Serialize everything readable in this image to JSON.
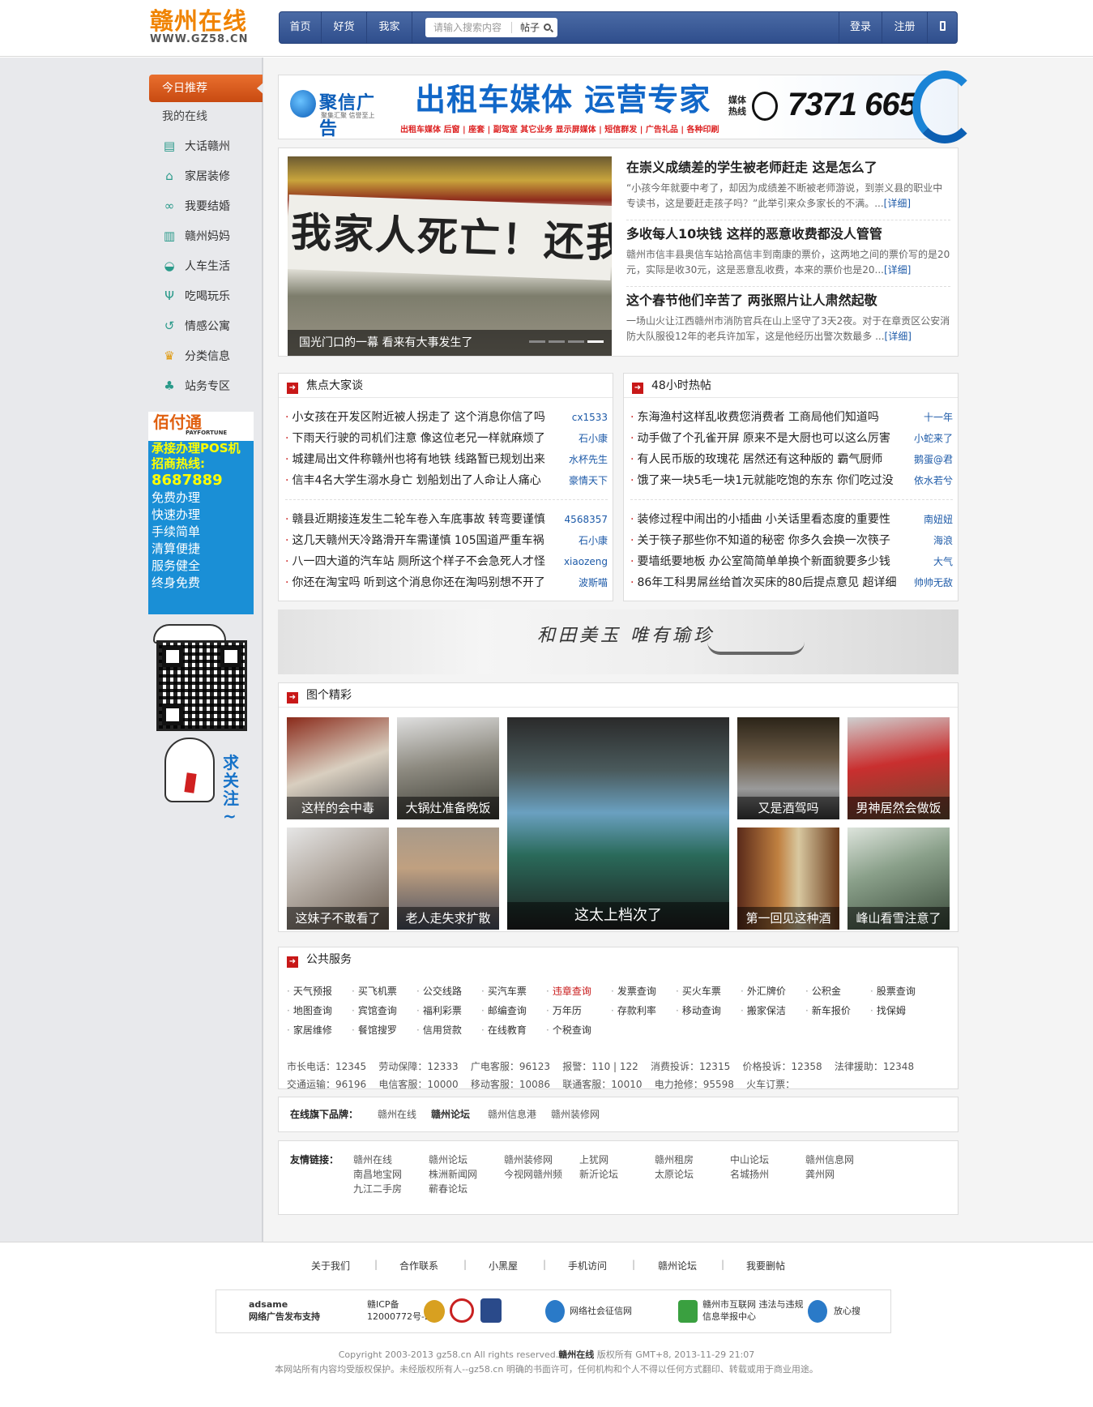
{
  "header": {
    "logo_cn": "赣州在线",
    "logo_url": "WWW.GZ58.CN",
    "nav": [
      {
        "label": "首页"
      },
      {
        "label": "好货"
      },
      {
        "label": "我家"
      }
    ],
    "search_placeholder": "请输入搜索内容",
    "search_category": "帖子",
    "login": "登录",
    "register": "注册"
  },
  "sidebar": {
    "today": "今日推荐",
    "mine": "我的在线",
    "items": [
      {
        "label": "大话赣州",
        "icon": "chat-icon"
      },
      {
        "label": "家居装修",
        "icon": "house-icon"
      },
      {
        "label": "我要结婚",
        "icon": "rings-icon"
      },
      {
        "label": "赣州妈妈",
        "icon": "crib-icon"
      },
      {
        "label": "人车生活",
        "icon": "car-icon"
      },
      {
        "label": "吃喝玩乐",
        "icon": "cutlery-icon"
      },
      {
        "label": "情感公寓",
        "icon": "heart-arrow-icon"
      },
      {
        "label": "分类信息",
        "icon": "coins-icon"
      },
      {
        "label": "站务专区",
        "icon": "people-icon"
      }
    ],
    "ad_pay": {
      "brand": "佰付通",
      "brand_en": "PAYFORTUNE",
      "line1": "承接办理POS机",
      "line2": "招商热线:",
      "phone": "8687889",
      "features": [
        "免费办理",
        "快速办理",
        "手续简单",
        "清算便捷",
        "服务健全",
        "终身免费"
      ]
    },
    "qr_text": "求关注~"
  },
  "banner": {
    "brand": "聚信广告",
    "brand_sub": "聚集汇聚 信誉至上",
    "headline": "出租车媒体 运营专家",
    "sub": "出租车媒体 后窗 | 座套 | 副驾室   其它业务 显示屏媒体 | 短信群发 | 广告礼品 | 各种印刷",
    "media_label": "媒体热线",
    "phone": "7371 665"
  },
  "slide": {
    "caption": "国光门口的一幕 看来有大事发生了",
    "banner_text": "我家人死亡！还我"
  },
  "articles": [
    {
      "title": "在崇义成绩差的学生被老师赶走 这是怎么了",
      "summary": "“小孩今年就要中考了，却因为成绩差不断被老师游说，到崇义县的职业中专读书，这是要赶走孩子吗？”此举引来众多家长的不满。...",
      "more": "[详细]"
    },
    {
      "title": "多收每人10块钱 这样的恶意收费都没人管管",
      "summary": "赣州市信丰县奥信车站拾高信丰到南康的票价，这两地之间的票价写的是20元，实际是收30元，这是恶意乱收费，本来的票价也是20...",
      "more": "[详细]"
    },
    {
      "title": "这个春节他们辛苦了 两张照片让人肃然起敬",
      "summary": "一场山火让江西赣州市消防官兵在山上坚守了3天2夜。对于在章贡区公安消防大队服役12年的老兵许加军，这是他经历出警次数最多 ...",
      "more": "[详细]"
    }
  ],
  "focus": {
    "title": "焦点大家谈",
    "rows": [
      {
        "text": "小女孩在开发区附近被人拐走了 这个消息你信了吗",
        "author": "cx1533"
      },
      {
        "text": "下雨天行驶的司机们注意 像这位老兄一样就麻烦了",
        "author": "石小康"
      },
      {
        "text": "城建局出文件称赣州也将有地铁 线路暂已规划出来",
        "author": "水杯先生"
      },
      {
        "text": "信丰4名大学生溺水身亡 划船划出了人命让人痛心",
        "author": "豪情天下"
      },
      {
        "text": "赣县近期接连发生二轮车卷入车底事故 转弯要谨慎",
        "author": "4568357"
      },
      {
        "text": "这几天赣州天冷路滑开车需谨慎 105国道严重车祸",
        "author": "石小康"
      },
      {
        "text": "八一四大道的汽车站 厕所这个样子不会急死人才怪",
        "author": "xiaozeng"
      },
      {
        "text": "你还在淘宝吗 听到这个消息你还在淘吗别想不开了",
        "author": "波斯喵"
      }
    ]
  },
  "hot48": {
    "title": "48小时热帖",
    "rows": [
      {
        "text": "东海渔村这样乱收费您消费者 工商局他们知道吗",
        "author": "十一年"
      },
      {
        "text": "动手做了个孔雀开屏 原来不是大厨也可以这么厉害",
        "author": "小蛇来了"
      },
      {
        "text": "有人民币版的玫瑰花 居然还有这种版的 霸气厨师",
        "author": "鹅蛋@君"
      },
      {
        "text": "饿了来一块5毛一块1元就能吃饱的东东 你们吃过没",
        "author": "依水若兮"
      },
      {
        "text": "装修过程中闹出的小插曲 小关话里看态度的重要性",
        "author": "南妞妞"
      },
      {
        "text": "关于筷子那些你不知道的秘密 你多久会换一次筷子",
        "author": "海浪"
      },
      {
        "text": "要墙纸要地板 办公室简简单单换个新面貌要多少钱",
        "author": "大气"
      },
      {
        "text": "86年工科男屌丝给首次买床的80后提点意见 超详细",
        "author": "帅帅无敌"
      }
    ]
  },
  "scenic_text": "和田美玉  唯有瑜珍",
  "photos": {
    "title": "图个精彩",
    "items": [
      {
        "caption": "这样的会中毒"
      },
      {
        "caption": "大锅灶准备晚饭"
      },
      {
        "caption": "这太上档次了"
      },
      {
        "caption": "又是酒驾吗"
      },
      {
        "caption": "男神居然会做饭"
      },
      {
        "caption": "这妹子不敢看了"
      },
      {
        "caption": "老人走失求扩散"
      },
      {
        "caption": "第一回见这种酒"
      },
      {
        "caption": "峰山看雪注意了"
      }
    ]
  },
  "service": {
    "title": "公共服务",
    "items": [
      "天气预报",
      "买飞机票",
      "公交线路",
      "买汽车票",
      "违章查询",
      "发票查询",
      "买火车票",
      "外汇牌价",
      "公积金",
      "股票查询",
      "地图查询",
      "宾馆查询",
      "福利彩票",
      "邮编查询",
      "万年历",
      "存款利率",
      "移动查询",
      "搬家保洁",
      "新车报价",
      "找保姆",
      "家居维修",
      "餐馆搜罗",
      "信用贷款",
      "在线教育",
      "个税查询"
    ],
    "hotlines1": "市长电话：12345    劳动保障：12333    广电客服：96123    报警：110 | 122    消费投诉：12315    价格投诉：12358    法律援助：12348",
    "hotlines2": "交通运输：96196    电信客服：10000    移动客服：10086    联通客服：10010    电力抢修：95598    火车订票："
  },
  "brands": {
    "label": "在线旗下品牌：",
    "items": [
      "赣州在线",
      "赣州论坛",
      "赣州信息港",
      "赣州装修网"
    ]
  },
  "links": {
    "label": "友情链接：",
    "items": [
      "赣州在线",
      "赣州论坛",
      "赣州装修网",
      "上犹网",
      "赣州租房",
      "中山论坛",
      "赣州信息网",
      "南昌地宝网",
      "株洲新闻网",
      "今视网赣州频",
      "新沂论坛",
      "太原论坛",
      "名城扬州",
      "龚州网",
      "九江二手房",
      "蕲春论坛"
    ]
  },
  "footer": {
    "nav": [
      "关于我们",
      "合作联系",
      "小黑屋",
      "手机访问",
      "赣州论坛",
      "我要删帖"
    ],
    "badges": [
      {
        "label": "adsame\n网络广告发布支持"
      },
      {
        "label": "赣ICP备\n12000772号-2"
      },
      {
        "label": "网络社会征信网"
      },
      {
        "label": "赣州市互联网 违法与违规\n信息举报中心"
      },
      {
        "label": "放心搜"
      }
    ],
    "copy_a": "Copyright 2003-2013 gz58.cn All rights reserved.",
    "copy_b": "赣州在线",
    "copy_c": " 版权所有 GMT+8, 2013-11-29 21:07",
    "copy2": "本网站所有内容均受版权保护。未经版权所有人--gz58.cn 明确的书面许可，任何机构和个人不得以任何方式翻印、转载或用于商业用途。"
  }
}
